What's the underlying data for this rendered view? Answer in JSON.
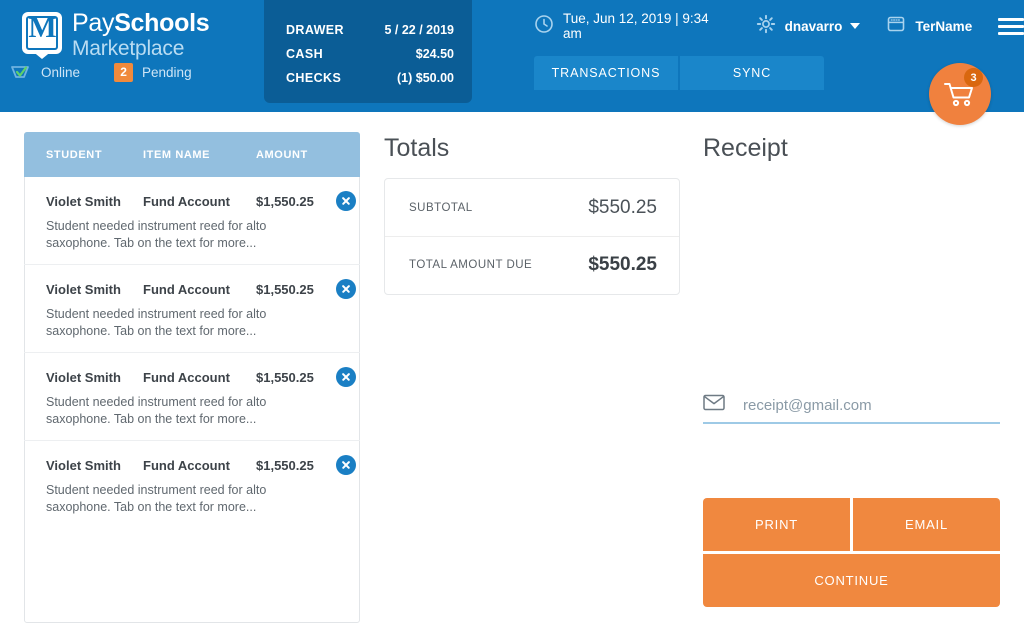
{
  "header": {
    "logo": {
      "mark_letter": "M",
      "line1_light": "Pay",
      "line1_bold": "Schools",
      "line2": "Marketplace"
    },
    "status": [
      {
        "icon": "cloud-check-icon",
        "label": "Online"
      },
      {
        "icon": "pending-count-badge",
        "count": "2",
        "label": "Pending"
      }
    ],
    "drawer": {
      "rows": [
        {
          "key": "DRAWER",
          "value": "5 / 22 / 2019"
        },
        {
          "key": "CASH",
          "value": "$24.50"
        },
        {
          "key": "CHECKS",
          "value": "(1) $50.00"
        }
      ]
    },
    "nav": {
      "datetime": "Tue, Jun 12, 2019 | 9:34 am",
      "user": "dnavarro",
      "terminal": "TerName"
    },
    "buttons": {
      "transactions": "TRANSACTIONS",
      "sync": "SYNC"
    },
    "cart": {
      "count": "3"
    }
  },
  "list": {
    "columns": [
      "STUDENT",
      "ITEM NAME",
      "AMOUNT"
    ],
    "rows": [
      {
        "student": "Violet Smith",
        "item": "Fund Account",
        "amount": "$1,550.25",
        "description": "Student needed instrument reed for alto saxophone. Tab on the text for more..."
      },
      {
        "student": "Violet Smith",
        "item": "Fund Account",
        "amount": "$1,550.25",
        "description": "Student needed instrument reed for alto saxophone. Tab on the text for more..."
      },
      {
        "student": "Violet Smith",
        "item": "Fund Account",
        "amount": "$1,550.25",
        "description": "Student needed instrument reed for alto saxophone. Tab on the text for more..."
      },
      {
        "student": "Violet Smith",
        "item": "Fund Account",
        "amount": "$1,550.25",
        "description": "Student needed instrument reed for alto saxophone. Tab on the text for more..."
      }
    ]
  },
  "totals": {
    "title": "Totals",
    "subtotal_label": "SUBTOTAL",
    "subtotal_value": "$550.25",
    "total_label": "TOTAL AMOUNT DUE",
    "total_value": "$550.25"
  },
  "receipt": {
    "title": "Receipt",
    "email_placeholder": "receipt@gmail.com",
    "email_value": "",
    "print_label": "PRINT",
    "email_label": "EMAIL",
    "continue_label": "CONTINUE"
  },
  "colors": {
    "header_blue": "#0e76bc",
    "drawer_blue": "#0b5d96",
    "accent_orange": "#f0883f",
    "table_head_blue": "#93bfdf",
    "delete_blue": "#1a7fc4"
  }
}
